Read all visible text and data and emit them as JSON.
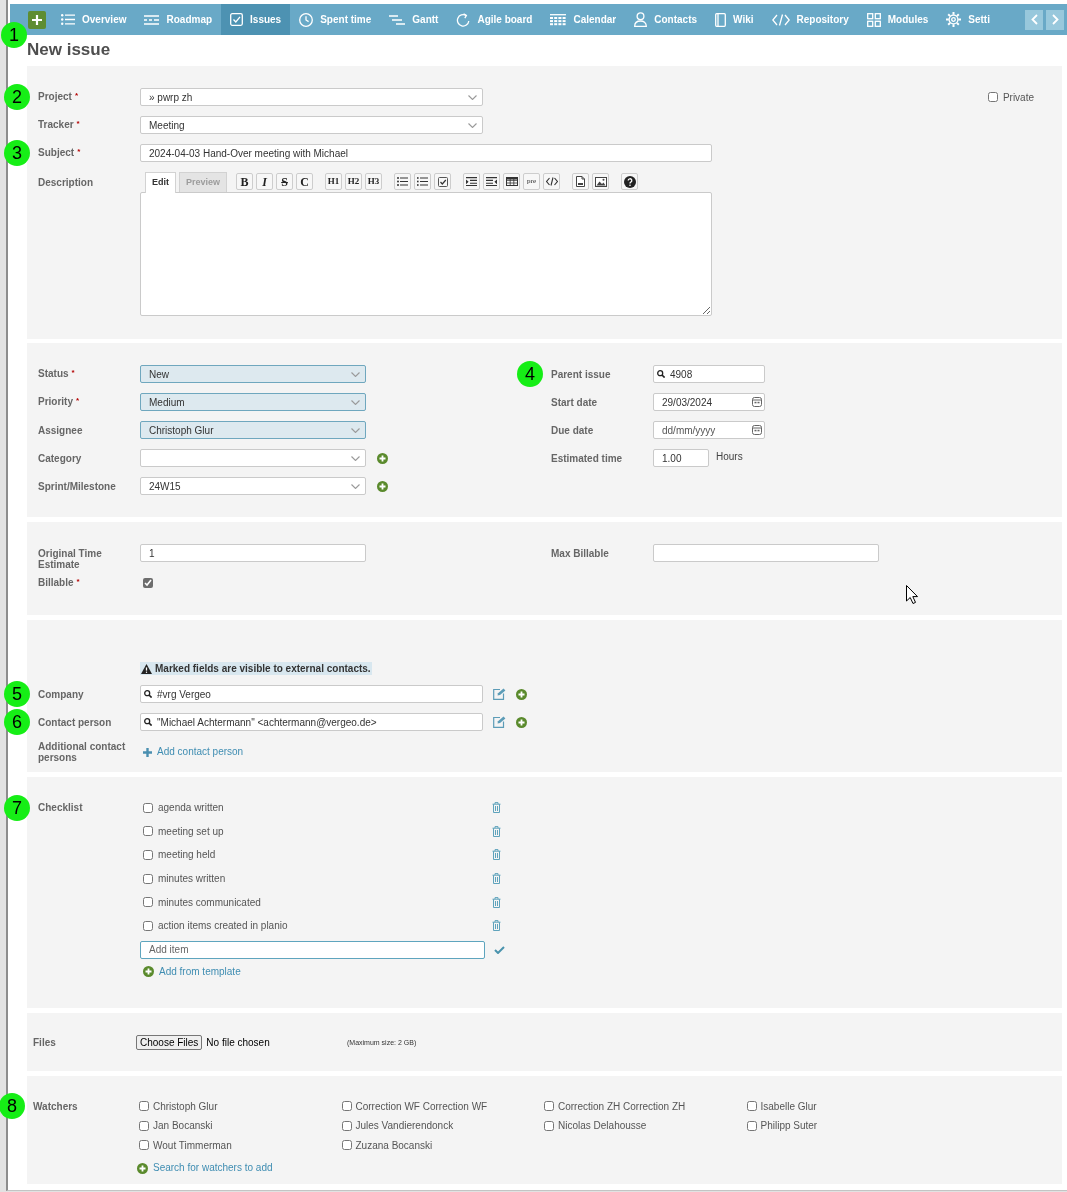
{
  "nav": {
    "items": [
      {
        "label": "Overview",
        "selected": false
      },
      {
        "label": "Roadmap",
        "selected": false
      },
      {
        "label": "Issues",
        "selected": true
      },
      {
        "label": "Spent time",
        "selected": false
      },
      {
        "label": "Gantt",
        "selected": false
      },
      {
        "label": "Agile board",
        "selected": false
      },
      {
        "label": "Calendar",
        "selected": false
      },
      {
        "label": "Contacts",
        "selected": false
      },
      {
        "label": "Wiki",
        "selected": false
      },
      {
        "label": "Repository",
        "selected": false
      },
      {
        "label": "Modules",
        "selected": false
      },
      {
        "label": "Setti",
        "selected": false
      }
    ]
  },
  "header": {
    "title": "New issue",
    "marker": "1"
  },
  "general": {
    "fields": [
      {
        "kind": "select",
        "label": "Project",
        "required_mark": "*",
        "marker": "2",
        "value": "» pwrp zh",
        "highlighted": false
      },
      {
        "kind": "select",
        "label": "Tracker",
        "required_mark": "*",
        "value": "Meeting",
        "highlighted": false
      },
      {
        "kind": "text",
        "label": "Subject",
        "required_mark": "*",
        "marker": "3",
        "value": "2024-04-03 Hand-Over meeting with Michael"
      }
    ],
    "private": {
      "label": "Private",
      "checked": false
    },
    "description": {
      "label": "Description",
      "tabs": [
        {
          "label": "Edit",
          "selected": true
        },
        {
          "label": "Preview",
          "selected": false
        }
      ],
      "toolbar": [
        [
          {
            "kind": "bold",
            "label": "B"
          },
          {
            "kind": "italic",
            "label": "I"
          },
          {
            "kind": "strike",
            "label": "S"
          },
          {
            "kind": "code",
            "label": "C"
          }
        ],
        [
          {
            "kind": "heading",
            "label": "H1"
          },
          {
            "kind": "heading",
            "label": "H2"
          },
          {
            "kind": "heading",
            "label": "H3"
          }
        ],
        [
          {
            "kind": "bullets"
          },
          {
            "kind": "numbers"
          },
          {
            "kind": "tasks"
          }
        ],
        [
          {
            "kind": "quote"
          },
          {
            "kind": "unquote"
          },
          {
            "kind": "table"
          },
          {
            "kind": "pre",
            "label": "pre"
          },
          {
            "kind": "snippet"
          }
        ],
        [
          {
            "kind": "file"
          },
          {
            "kind": "image"
          }
        ],
        [
          {
            "kind": "help"
          }
        ]
      ]
    }
  },
  "attributes": {
    "left": [
      {
        "kind": "select",
        "label": "Status",
        "required_mark": "*",
        "value": "New",
        "highlighted": true
      },
      {
        "kind": "select",
        "label": "Priority",
        "required_mark": "*",
        "value": "Medium",
        "highlighted": true
      },
      {
        "kind": "select",
        "label": "Assignee",
        "value": "Christoph Glur",
        "highlighted": true
      },
      {
        "kind": "select",
        "label": "Category",
        "highlighted": false,
        "add": true
      },
      {
        "kind": "select",
        "label": "Sprint/Milestone",
        "value": "24W15",
        "highlighted": false,
        "add": true
      }
    ],
    "right": [
      {
        "kind": "lookup",
        "label": "Parent issue",
        "marker": "4",
        "value": "4908"
      },
      {
        "kind": "date",
        "label": "Start date",
        "value": "29/03/2024"
      },
      {
        "kind": "date",
        "label": "Due date",
        "placeholder": "dd/mm/yyyy"
      },
      {
        "kind": "hours",
        "label": "Estimated time",
        "value": "1.00",
        "unit": "Hours"
      }
    ]
  },
  "estimates": {
    "left": [
      {
        "kind": "text",
        "label": "Original Time Estimate",
        "value": "1"
      },
      {
        "kind": "checkbox",
        "label": "Billable",
        "required_mark": "*",
        "checked": true
      }
    ],
    "right": [
      {
        "kind": "text",
        "label": "Max Billable"
      }
    ]
  },
  "contacts": {
    "notice": "Marked fields are visible to external contacts.",
    "fields": [
      {
        "kind": "lookup",
        "label": "Company",
        "marker": "5",
        "value": "#vrg Vergeo",
        "edit": true,
        "add": true
      },
      {
        "kind": "lookup",
        "label": "Contact person",
        "marker": "6",
        "value": "\"Michael Achtermann\" <achtermann@vergeo.de>",
        "edit": true,
        "add": true
      },
      {
        "kind": "link",
        "label": "Additional contact persons",
        "link": "Add contact person"
      }
    ]
  },
  "checklist": {
    "label": "Checklist",
    "marker": "7",
    "items": [
      {
        "text": "agenda written",
        "checked": false
      },
      {
        "text": "meeting set up",
        "checked": false
      },
      {
        "text": "meeting held",
        "checked": false
      },
      {
        "text": "minutes written",
        "checked": false
      },
      {
        "text": "minutes communicated",
        "checked": false
      },
      {
        "text": "action items created in planio",
        "checked": false
      }
    ],
    "new_item": {
      "placeholder": "Add item"
    },
    "template_link": "Add from template"
  },
  "files": {
    "label": "Files",
    "button": "Choose Files",
    "status": "No file chosen",
    "note": "(Maximum size: 2 GB)"
  },
  "watchers": {
    "label": "Watchers",
    "marker": "8",
    "people": [
      {
        "name": "Christoph Glur",
        "checked": false
      },
      {
        "name": "Correction WF Correction WF",
        "checked": false
      },
      {
        "name": "Correction ZH Correction ZH",
        "checked": false
      },
      {
        "name": "Isabelle Glur",
        "checked": false
      },
      {
        "name": "Jan Bocanski",
        "checked": false
      },
      {
        "name": "Jules Vandierendonck",
        "checked": false
      },
      {
        "name": "Nicolas Delahousse",
        "checked": false
      },
      {
        "name": "Philipp Suter",
        "checked": false
      },
      {
        "name": "Wout Timmerman",
        "checked": false
      },
      {
        "name": "Zuzana Bocanski",
        "checked": false
      }
    ],
    "search_link": "Search for watchers to add"
  }
}
